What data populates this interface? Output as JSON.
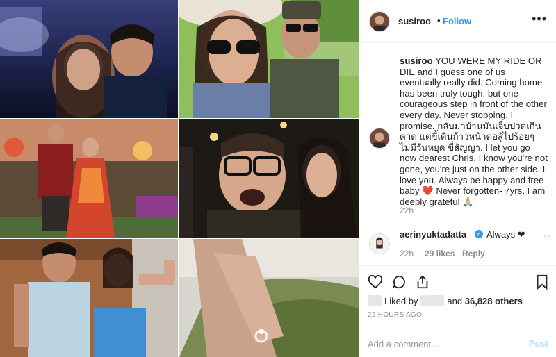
{
  "header": {
    "username": "susiroo",
    "separator": "•",
    "follow_label": "Follow",
    "more_icon": "more-dots-icon"
  },
  "caption": {
    "username": "susiroo",
    "text_1": "YOU WERE MY RIDE OR DIE and I guess one of us eventually really did. Coming home has been truly tough, but one courageous step in front of the other every day. Never stopping, I promise. กลับมาบ้านมันเจ็บปวดเกินคาด แต่ขี้เดินก้าวหน้าต่อสู้ไปร้อยๆ ไม่มีวันหยุด ขี่สัญญา. I let you go now dearest Chris. I know you're not gone, you're just on the other side. I love you. Always be happy and free baby ",
    "heart": "❤️",
    "text_2": " Never forgotten- 7yrs, I am deeply grateful ",
    "pray": "🙏🏼",
    "time": "22h"
  },
  "comment": {
    "username": "aerinyuktadatta",
    "verified_glyph": "✓",
    "text": "Always ❤",
    "time": "22h",
    "likes": "29 likes",
    "reply": "Reply",
    "like_icon": "♡"
  },
  "actions": {
    "liked_by_label": "Liked by",
    "and_label": "and",
    "others": "36,828 others",
    "posted_time": "22 HOURS AGO"
  },
  "comment_box": {
    "placeholder": "Add a comment…",
    "post_label": "Post"
  },
  "colors": {
    "link_blue": "#3897f0",
    "post_disabled": "#b2dffc",
    "muted": "#8e8e8e",
    "border": "#efefef"
  }
}
